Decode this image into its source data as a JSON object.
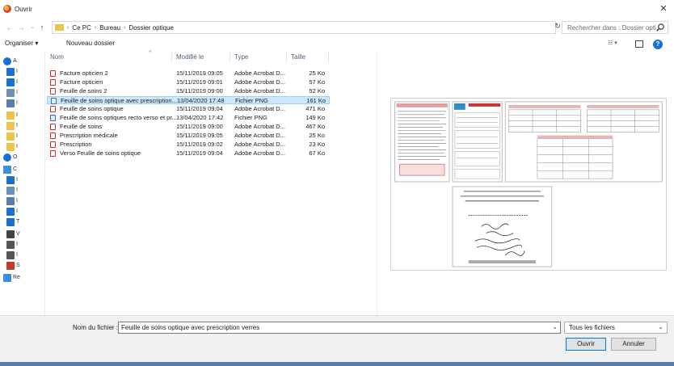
{
  "window": {
    "title": "Ouvrir",
    "close_glyph": "✕"
  },
  "nav": {
    "back_glyph": "←",
    "forward_glyph": "→",
    "recent_glyph": "⌄",
    "up_glyph": "↑",
    "breadcrumbs": [
      "Ce PC",
      "Bureau",
      "Dossier optique"
    ],
    "crumb_sep": "›",
    "dropdown_glyph": "⌄",
    "refresh_glyph": "↻",
    "search_placeholder": "Rechercher dans : Dossier opti..."
  },
  "toolbar": {
    "organize": "Organiser ▾",
    "new_folder": "Nouveau dossier",
    "view_glyph": "☷ ▾",
    "help_glyph": "?"
  },
  "sidebar": {
    "items": [
      {
        "icon": "star-icon",
        "label": "A",
        "color": "#1a6fd3"
      },
      {
        "icon": "desktop-icon",
        "label": "I",
        "color": "#1a6fd3"
      },
      {
        "icon": "download-icon",
        "label": "I",
        "color": "#1a6fd3"
      },
      {
        "icon": "document-icon",
        "label": "I",
        "color": "#6d8fb5"
      },
      {
        "icon": "picture-icon",
        "label": "I",
        "color": "#5a7bb0"
      },
      {
        "icon": "folder-icon",
        "label": "I",
        "color": "#f1c24b"
      },
      {
        "icon": "folder-icon",
        "label": "I",
        "color": "#f1c24b"
      },
      {
        "icon": "folder-icon",
        "label": "I",
        "color": "#f1c24b"
      },
      {
        "icon": "folder-icon",
        "label": "I",
        "color": "#f1c24b"
      },
      {
        "icon": "cloud-icon",
        "label": "O",
        "color": "#1a6fd3"
      },
      {
        "icon": "computer-icon",
        "label": "C",
        "color": "#3b8fe0"
      },
      {
        "icon": "desktop-icon",
        "label": "I",
        "color": "#1a6fd3"
      },
      {
        "icon": "document-icon",
        "label": "I",
        "color": "#6d8fb5"
      },
      {
        "icon": "picture-icon",
        "label": "I",
        "color": "#5a7bb0"
      },
      {
        "icon": "music-icon",
        "label": "I",
        "color": "#1a6fd3"
      },
      {
        "icon": "download-icon",
        "label": "T",
        "color": "#1a6fd3"
      },
      {
        "icon": "video-icon",
        "label": "V",
        "color": "#444444"
      },
      {
        "icon": "drive-icon",
        "label": "I",
        "color": "#555555"
      },
      {
        "icon": "drive-icon",
        "label": "I",
        "color": "#555555"
      },
      {
        "icon": "drive-icon",
        "label": "S",
        "color": "#c0392b"
      },
      {
        "icon": "network-icon",
        "label": "Ré",
        "color": "#3b8fe0"
      }
    ]
  },
  "columns": {
    "name": "Nom",
    "modified": "Modifié le",
    "type": "Type",
    "size": "Taille",
    "sort_glyph": "^"
  },
  "files": [
    {
      "name": "Facture opticien 2",
      "modified": "15/11/2019 09:05",
      "type": "Adobe Acrobat D...",
      "size": "25 Ko",
      "kind": "pdf",
      "selected": false
    },
    {
      "name": "Facture opticien",
      "modified": "15/11/2019 09:01",
      "type": "Adobe Acrobat D...",
      "size": "57 Ko",
      "kind": "pdf",
      "selected": false
    },
    {
      "name": "Feuille de soins 2",
      "modified": "15/11/2019 09:00",
      "type": "Adobe Acrobat D...",
      "size": "52 Ko",
      "kind": "pdf",
      "selected": false
    },
    {
      "name": "Feuille de soins optique avec prescription...",
      "modified": "13/04/2020 17:48",
      "type": "Fichier PNG",
      "size": "161 Ko",
      "kind": "png",
      "selected": true
    },
    {
      "name": "Feuille de soins optique",
      "modified": "15/11/2019 09:04",
      "type": "Adobe Acrobat D...",
      "size": "471 Ko",
      "kind": "pdf",
      "selected": false
    },
    {
      "name": "Feuille de soins optiques recto verso et pr...",
      "modified": "13/04/2020 17:42",
      "type": "Fichier PNG",
      "size": "149 Ko",
      "kind": "png",
      "selected": false
    },
    {
      "name": "Feuille de soins",
      "modified": "15/11/2019 09:00",
      "type": "Adobe Acrobat D...",
      "size": "467 Ko",
      "kind": "pdf",
      "selected": false
    },
    {
      "name": "Prescription médicale",
      "modified": "15/11/2019 09:05",
      "type": "Adobe Acrobat D...",
      "size": "25 Ko",
      "kind": "pdf",
      "selected": false
    },
    {
      "name": "Prescription",
      "modified": "15/11/2019 09:02",
      "type": "Adobe Acrobat D...",
      "size": "23 Ko",
      "kind": "pdf",
      "selected": false
    },
    {
      "name": "Verso Feuille de soins optique",
      "modified": "15/11/2019 09:04",
      "type": "Adobe Acrobat D...",
      "size": "67 Ko",
      "kind": "pdf",
      "selected": false
    }
  ],
  "footer": {
    "filename_label": "Nom du fichier :",
    "filename_value": "Feuille de soins optique avec prescription verres",
    "filetype_value": "Tous les fichiers",
    "dropdown_glyph": "⌄",
    "open_label": "Ouvrir",
    "cancel_label": "Annuler"
  },
  "colors": {
    "selection_bg": "#cce8ff",
    "selection_border": "#99d1ff",
    "accent": "#0078d7",
    "pdf_red": "#d12b2b"
  }
}
